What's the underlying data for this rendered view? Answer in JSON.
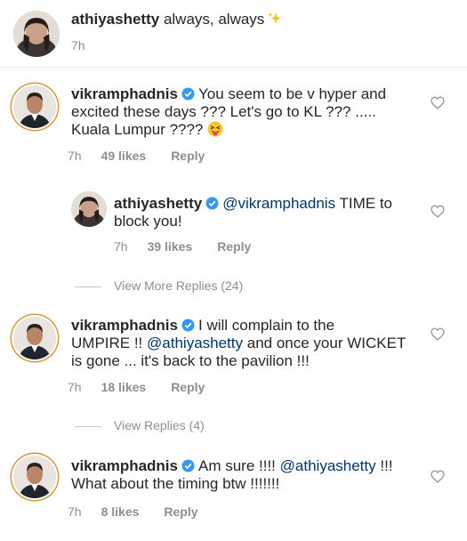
{
  "comments": [
    {
      "username": "athiyashetty",
      "text": "always, always",
      "time": "7h"
    },
    {
      "username": "vikramphadnis",
      "text_lines": [
        "You seem to be v hyper and",
        "excited these days ??? Let's go to KL ??? .....",
        "Kuala Lumpur ????"
      ],
      "time": "7h",
      "likes": "49 likes",
      "reply": "Reply"
    },
    {
      "username": "athiyashetty",
      "mention": "@vikramphadnis",
      "text_lines": [
        "TIME to",
        "block you!"
      ],
      "time": "7h",
      "likes": "39 likes",
      "reply": "Reply"
    },
    {
      "username": "vikramphadnis",
      "text_lines": [
        "I will complain to the",
        "UMPIRE !!",
        "and once your WICKET",
        "is gone ... it's back to the pavilion !!!"
      ],
      "mention": "@athiyashetty",
      "time": "7h",
      "likes": "18 likes",
      "reply": "Reply"
    },
    {
      "username": "vikramphadnis",
      "text_lines": [
        "Am sure !!!!",
        "!!!",
        "What about the timing btw !!!!!!!"
      ],
      "mention": "@athiyashetty",
      "time": "7h",
      "likes": "8 likes",
      "reply": "Reply"
    }
  ],
  "view_more_1": "View More Replies (24)",
  "view_more_2": "View Replies (4)",
  "icons": {
    "verified": "verified-badge-icon",
    "heart": "heart-outline-icon",
    "sparkles": "sparkles-emoji",
    "tongue": "tongue-out-emoji"
  },
  "colors": {
    "verified_blue": "#3897f0",
    "mention": "#003569",
    "meta_gray": "#8e8e8e",
    "story_ring": "#d29c3a"
  }
}
